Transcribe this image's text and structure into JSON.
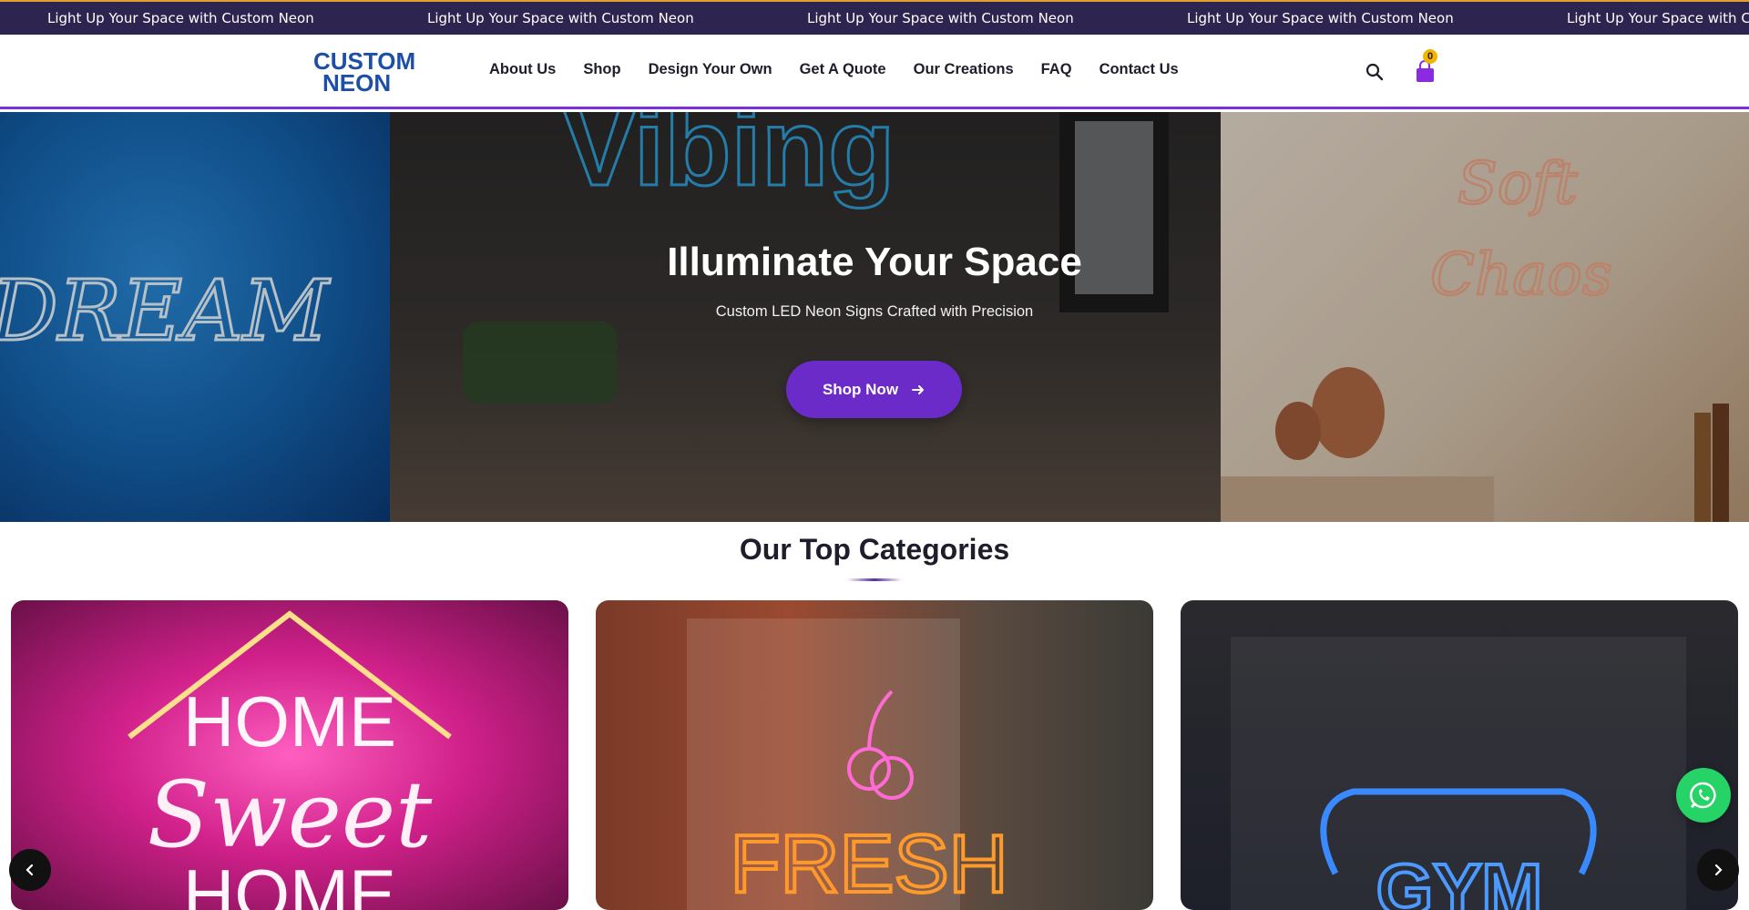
{
  "announcement": {
    "messages": [
      "Light Up Your Space with Custom Neon",
      "Light Up Your Space with Custom Neon",
      "Light Up Your Space with Custom Neon",
      "Light Up Your Space with Custom Neon",
      "Light Up Your Space with Custom Neon"
    ]
  },
  "header": {
    "logo_line1": "CUSTOM",
    "logo_line2": "NEON",
    "nav": [
      "About Us",
      "Shop",
      "Design Your Own",
      "Get A Quote",
      "Our Creations",
      "FAQ",
      "Contact Us"
    ],
    "cart_count": "0",
    "search_icon": "search-icon",
    "cart_icon": "shopping-bag-icon"
  },
  "hero": {
    "panel_texts": [
      "DREAM",
      "Vibing",
      "Soft",
      "Chaos"
    ],
    "title": "Illuminate Your Space",
    "subtitle": "Custom LED Neon Signs Crafted with Precision",
    "button_label": "Shop Now"
  },
  "categories": {
    "title": "Our Top Categories",
    "cards": [
      {
        "line1": "HOME",
        "line2": "Sweet",
        "line3": "HOME"
      },
      {
        "line1": "FRESH"
      },
      {
        "line1": "GYM"
      }
    ]
  },
  "colors": {
    "accent": "#6a2bc9",
    "announcement_bg": "#2d2550",
    "badge": "#f3b400",
    "whatsapp": "#25d366"
  }
}
